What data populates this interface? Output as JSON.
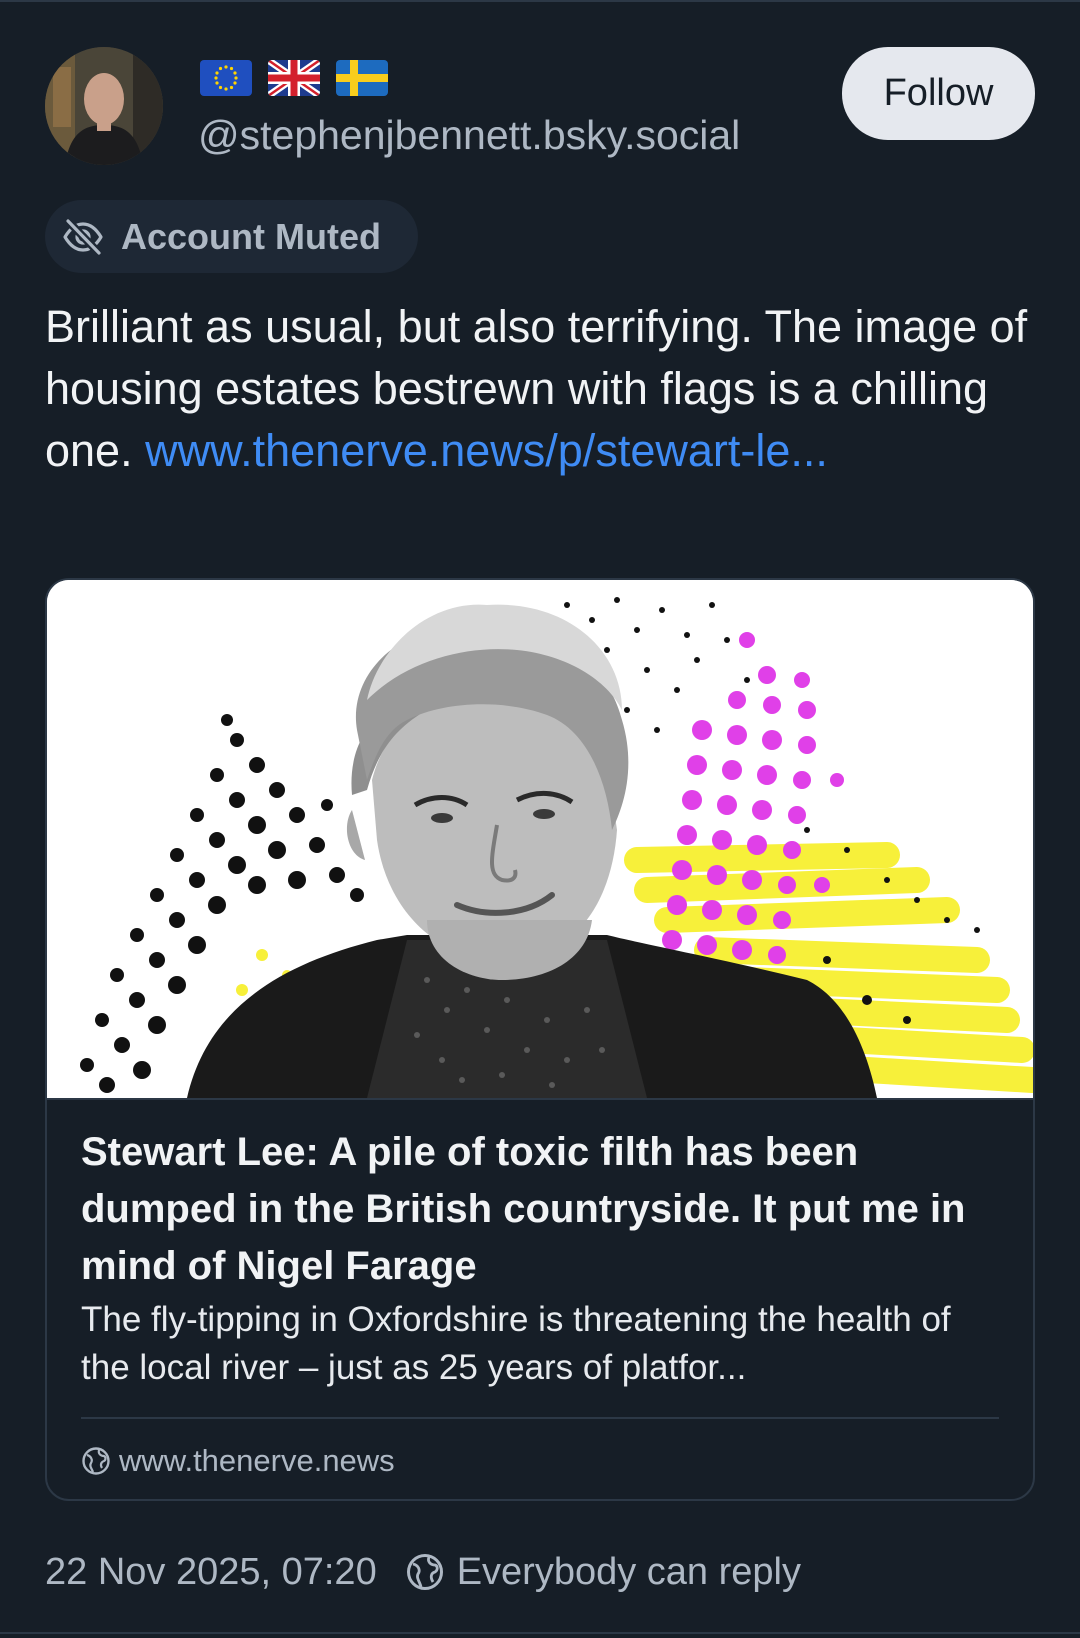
{
  "author": {
    "handle": "@stephenjbennett.bsky.social",
    "flags": [
      "eu-flag",
      "uk-flag",
      "sweden-flag"
    ],
    "follow_label": "Follow"
  },
  "moderation": {
    "label": "Account Muted",
    "icon": "eye-slash-icon"
  },
  "post": {
    "text": "Brilliant as usual, but also terrifying. The image of housing estates bestrewn with flags is a chilling one. ",
    "link_text": "www.thenerve.news/p/stewart-le..."
  },
  "link_card": {
    "title": "Stewart Lee: A pile of toxic filth has been dumped in the British countryside. It put me in mind of Nigel Farage",
    "description": "The fly-tipping in Oxfordshire is threatening the health of the local river – just as 25 years of platfor...",
    "domain": "www.thenerve.news",
    "domain_icon": "globe-icon"
  },
  "footer": {
    "timestamp": "22 Nov 2025, 07:20",
    "reply_setting": "Everybody can reply",
    "reply_icon": "globe-icon"
  },
  "colors": {
    "background": "#161e27",
    "link": "#3f8cf5",
    "muted_text": "#aeb8c4",
    "accent_magenta": "#e040e8",
    "accent_yellow": "#f7f03a"
  }
}
